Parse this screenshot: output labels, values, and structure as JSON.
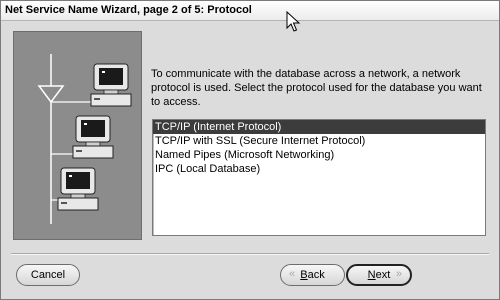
{
  "window": {
    "title": "Net Service Name Wizard, page 2 of 5: Protocol"
  },
  "content": {
    "description": "To communicate with the database across a network, a network protocol is used.  Select the protocol used for the database you want to access."
  },
  "protocols": [
    {
      "label": "TCP/IP (Internet Protocol)",
      "selected": true
    },
    {
      "label": "TCP/IP with SSL (Secure Internet Protocol)",
      "selected": false
    },
    {
      "label": "Named Pipes (Microsoft Networking)",
      "selected": false
    },
    {
      "label": "IPC (Local Database)",
      "selected": false
    }
  ],
  "buttons": {
    "cancel": "Cancel",
    "back": "Back",
    "next": "Next"
  },
  "icons": {
    "illustration": "network-computers-illustration",
    "cursor": "mouse-pointer-icon",
    "back_arrow": "double-chevron-left-icon",
    "next_arrow": "double-chevron-right-icon"
  },
  "colors": {
    "dialog_bg": "#dcdcdc",
    "illustration_bg": "#8c8c8c",
    "selection_bg": "#3c3c3c",
    "selection_text": "#ffffff"
  }
}
